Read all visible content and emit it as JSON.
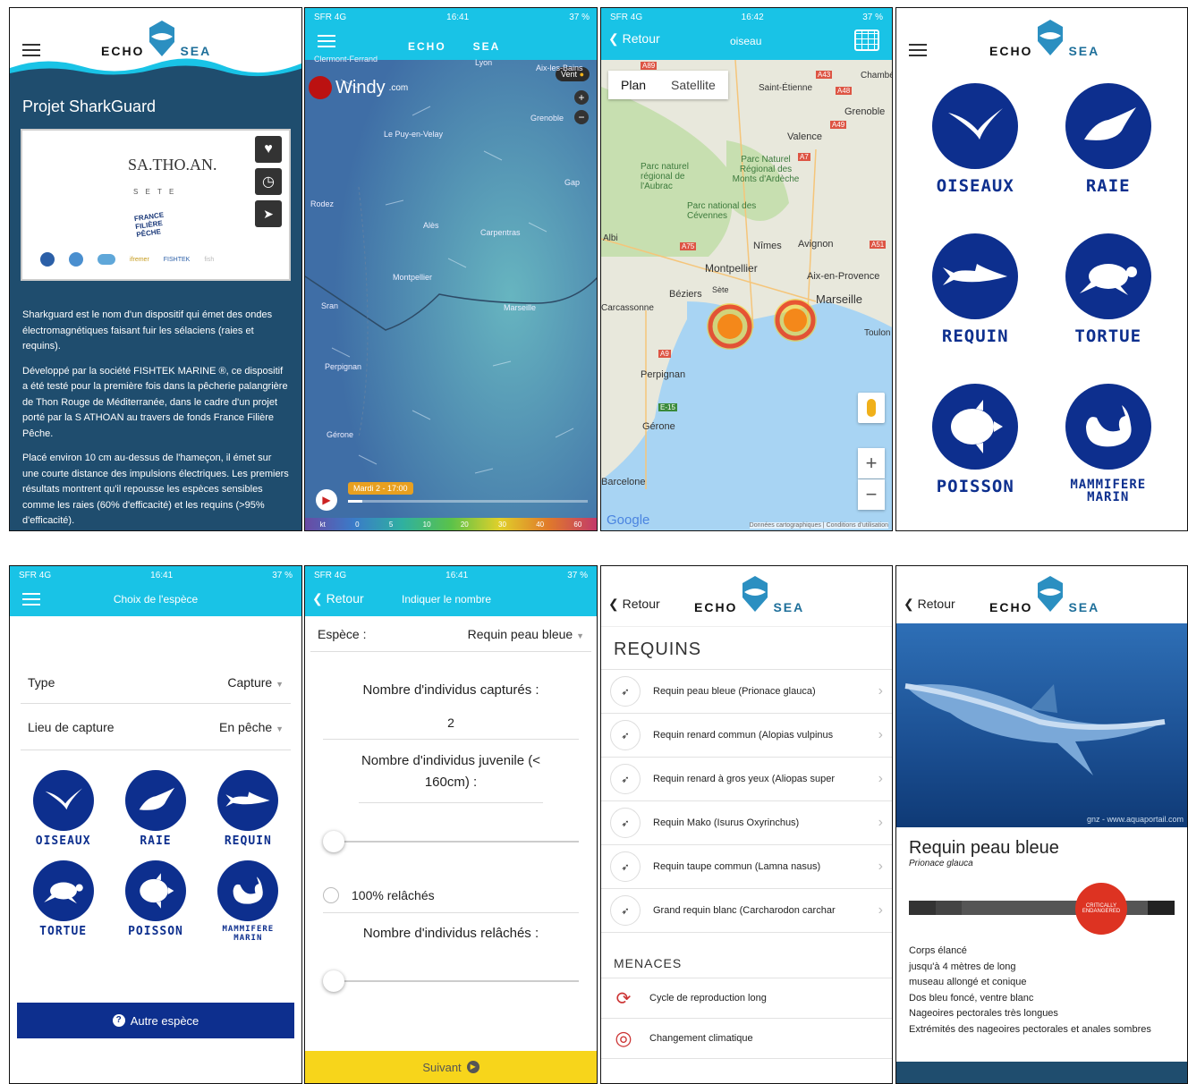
{
  "status": {
    "carrier": "SFR",
    "net": "4G",
    "battery": "37 %",
    "t1": "16:41",
    "t2": "16:42"
  },
  "brand": {
    "echo": "ECHO",
    "sea": "SEA"
  },
  "s1": {
    "title": "Projet SharkGuard",
    "sponsor": "SA.THO.AN.",
    "sponsor_sub": "S E T E",
    "ff": "FRANCE FILIÈRE PÊCHE",
    "logos": [
      "FISHTEK",
      "ifremer",
      "fish"
    ],
    "p1": "Sharkguard est le nom d'un dispositif qui émet des ondes électromagnétiques faisant fuir les sélaciens (raies et requins).",
    "p2": "Développé par la société FISHTEK MARINE ®, ce dispositif a été testé pour la première fois dans la pêcherie palangrière de Thon Rouge de Méditerranée, dans le cadre d'un projet porté par la S ATHOAN au travers de fonds France Filière Pêche.",
    "p3": "Placé environ 10 cm au-dessus de l'hameçon, il émet sur une courte distance des impulsions électriques. Les premiers résultats montrent qu'il repousse les espèces sensibles comme les raies (60% d'efficacité) et les requins (>95% d'efficacité)."
  },
  "s2": {
    "windy": "Windy",
    "windy_dom": ".com",
    "vent": "Vent",
    "time": "Mardi 2 - 17:00",
    "cities": [
      "Clermont-Ferrand",
      "Lyon",
      "Aix-les-Bains",
      "Grenoble",
      "Le Puy-en-Velay",
      "Gap",
      "Rodez",
      "Alès",
      "Carpentras",
      "Montpellier",
      "Marseille",
      "Sran",
      "Perpignan",
      "Gérone"
    ],
    "scale": [
      "kt",
      "0",
      "5",
      "10",
      "20",
      "30",
      "40",
      "60"
    ]
  },
  "s3": {
    "back": "Retour",
    "title": "oiseau",
    "tab_plan": "Plan",
    "tab_sat": "Satellite",
    "places": [
      "Chambé",
      "Saint-Étienne",
      "Grenoble",
      "Valence",
      "Parc naturel régional de l'Aubrac",
      "Parc Naturel Régional des Monts d'Ardèche",
      "Parc national des Cévennes",
      "Albi",
      "Nîmes",
      "Avignon",
      "Montpellier",
      "Aix-en-Provence",
      "Béziers",
      "Sète",
      "Marseille",
      "Carcassonne",
      "Toulon",
      "Perpignan",
      "Gérone",
      "Barcelone"
    ],
    "roads": [
      "A89",
      "A43",
      "A48",
      "A49",
      "A7",
      "A75",
      "A51",
      "A9",
      "E-15"
    ],
    "google": "Google",
    "credits": "Données cartographiques",
    "terms": "Conditions d'utilisation"
  },
  "s4": {
    "items": [
      "OISEAUX",
      "RAIE",
      "REQUIN",
      "TORTUE",
      "POISSON",
      "MAMMIFERE MARIN"
    ]
  },
  "s5": {
    "title": "Choix de l'espèce",
    "type_label": "Type",
    "type_value": "Capture",
    "lieu_label": "Lieu de capture",
    "lieu_value": "En pêche",
    "items": [
      "OISEAUX",
      "RAIE",
      "REQUIN",
      "TORTUE",
      "POISSON",
      "MAMMIFERE MARIN"
    ],
    "other": "Autre espèce"
  },
  "s6": {
    "back": "Retour",
    "title": "Indiquer le nombre",
    "espece_label": "Espèce :",
    "espece_value": "Requin peau bleue",
    "q1": "Nombre d'individus capturés :",
    "q1_value": "2",
    "q2": "Nombre d'individus juvenile (< 160cm) :",
    "radio": "100% relâchés",
    "q3": "Nombre d'individus relâchés :",
    "next": "Suivant"
  },
  "s7": {
    "back": "Retour",
    "heading": "REQUINS",
    "species": [
      "Requin peau bleue (Prionace glauca)",
      "Requin renard commun (Alopias vulpinus",
      "Requin renard à gros yeux (Aliopas super",
      "Requin Mako (Isurus Oxyrinchus)",
      "Requin taupe commun (Lamna nasus)",
      "Grand requin blanc (Carcharodon carchar"
    ],
    "menaces": "MENACES",
    "threats": [
      "Cycle de reproduction long",
      "Changement climatique"
    ]
  },
  "s8": {
    "back": "Retour",
    "credit": "gnz - www.aquaportail.com",
    "name": "Requin peau bleue",
    "latin": "Prionace glauca",
    "status": "CRITICALLY ENDANGERED",
    "desc": [
      "Corps élancé",
      "jusqu'à 4 mètres de long",
      "museau allongé et conique",
      "Dos bleu foncé, ventre blanc",
      "Nageoires pectorales très longues",
      "Extrémités des nageoires pectorales et anales sombres"
    ]
  },
  "colors": {
    "navy": "#0d2f8e",
    "cyan": "#19c3e6",
    "panel": "#1f4d6e",
    "yellow": "#f7d51b"
  }
}
